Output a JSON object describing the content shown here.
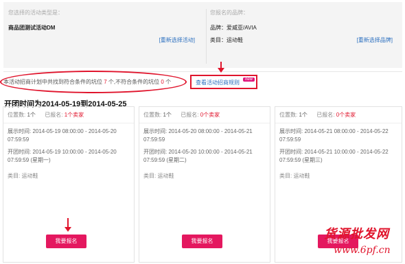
{
  "selection": {
    "activity_type_hint": "您选择的活动类型是：",
    "activity_type": "商品团测试活动DM",
    "reselect_activity": "[重新选择活动]",
    "brand_hint": "您报名的品牌：",
    "brand": "品牌：爱威亚/AVIA",
    "category": "类目：运动鞋",
    "reselect_brand": "[重新选择品牌]"
  },
  "summary": {
    "prefix": "本活动招商计划中共找到符合条件的坑位",
    "match_count": "7",
    "middle": "个,不符合条件的坑位",
    "nomatch_count": "0",
    "suffix": "个"
  },
  "rules": {
    "link": "查看活动招商规则",
    "badge": "new"
  },
  "period": "开团时间为2014-05-19到2014-05-25",
  "cards": [
    {
      "slots_label": "位置数:",
      "slots": "1个",
      "signed_label": "已报名:",
      "signed": "1个卖家",
      "display_time": "展示时间: 2014-05-19 08:00:00 - 2014-05-20 07:59:59",
      "open_time": "开团时间: 2014-05-19 10:00:00 - 2014-05-20 07:59:59 (星期一)",
      "category": "类目: 运动鞋",
      "button": "我要报名"
    },
    {
      "slots_label": "位置数:",
      "slots": "1个",
      "signed_label": "已报名:",
      "signed": "0个卖家",
      "display_time": "展示时间: 2014-05-20 08:00:00 - 2014-05-21 07:59:59",
      "open_time": "开团时间: 2014-05-20 10:00:00 - 2014-05-21 07:59:59 (星期二)",
      "category": "类目: 运动鞋",
      "button": "我要报名"
    },
    {
      "slots_label": "位置数:",
      "slots": "1个",
      "signed_label": "已报名:",
      "signed": "0个卖家",
      "display_time": "展示时间: 2014-05-21 08:00:00 - 2014-05-22 07:59:59",
      "open_time": "开团时间: 2014-05-21 10:00:00 - 2014-05-22 07:59:59 (星期三)",
      "category": "类目: 运动鞋",
      "button": "我要报名"
    }
  ],
  "watermark": {
    "line1": "货源批发网",
    "line2": "www.6pf.cn"
  },
  "colors": {
    "accent": "#e0142c",
    "button": "#e4185f",
    "link": "#2b6fbf"
  }
}
